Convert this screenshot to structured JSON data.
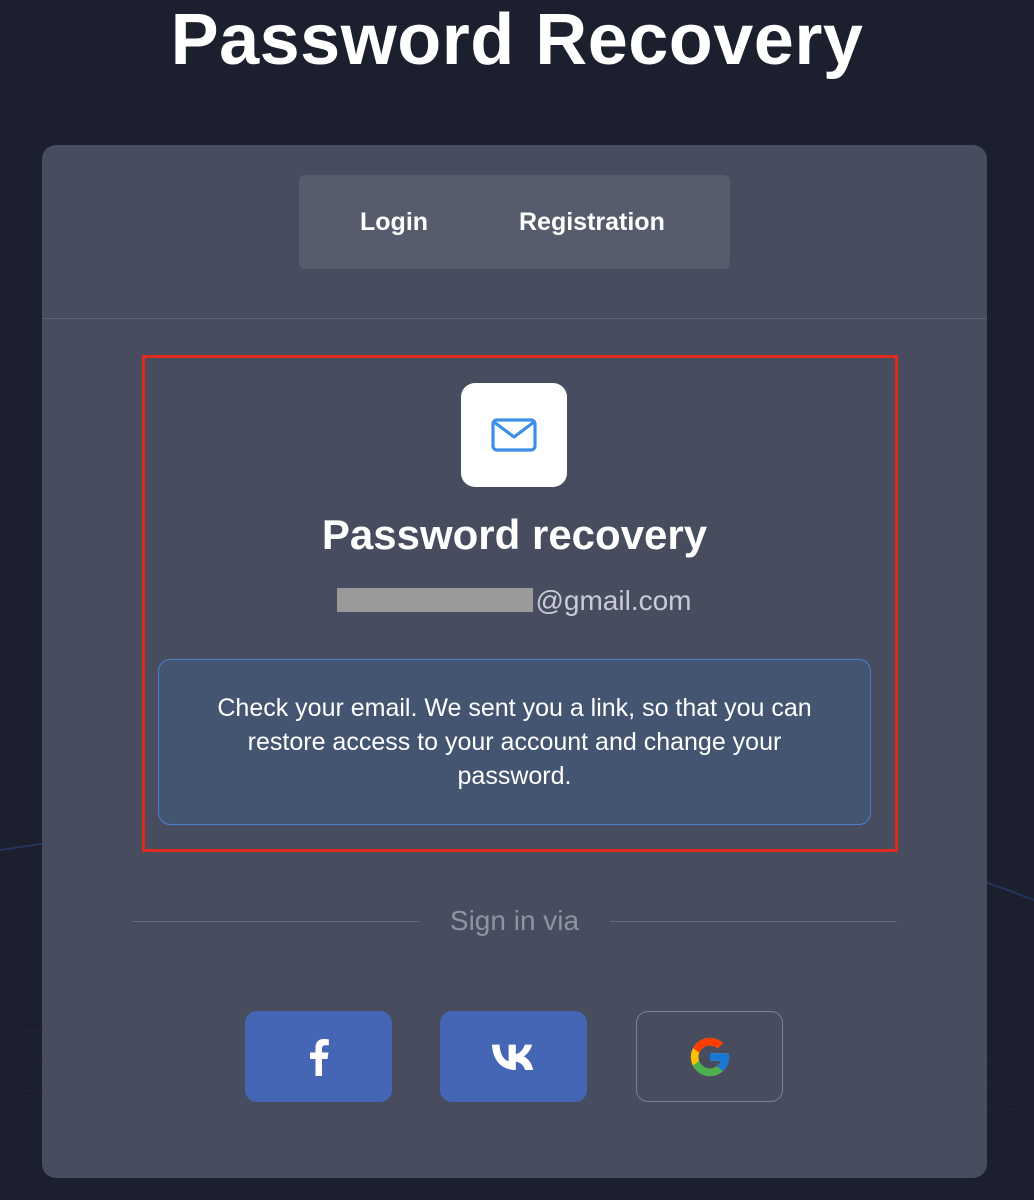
{
  "page": {
    "title": "Password Recovery"
  },
  "tabs": [
    {
      "label": "Login"
    },
    {
      "label": "Registration"
    }
  ],
  "recovery": {
    "icon": "mail-icon",
    "heading": "Password recovery",
    "email_visible": "@gmail.com",
    "message": "Check your email. We sent you a link, so that you can restore access to your account and change your password."
  },
  "signin": {
    "label": "Sign in via",
    "providers": [
      {
        "name": "facebook",
        "icon": "facebook-icon"
      },
      {
        "name": "vk",
        "icon": "vk-icon"
      },
      {
        "name": "google",
        "icon": "google-icon"
      }
    ]
  },
  "colors": {
    "background": "#1b1f2e",
    "card": "#474c5e",
    "tab_bar": "#575c6d",
    "highlight_border": "#e02a1b",
    "message_box": "#435571",
    "message_border": "#4a7fd0",
    "social_button": "#4466b4",
    "mail_icon": "#3d8ee6"
  }
}
